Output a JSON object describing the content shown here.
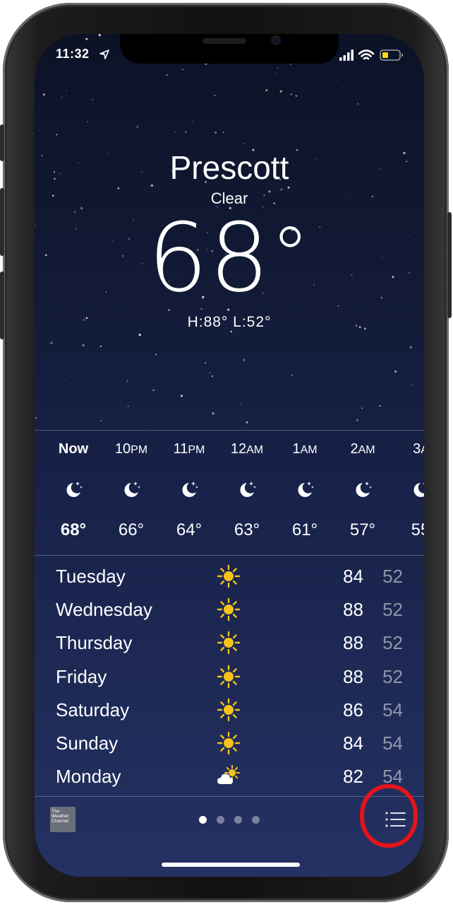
{
  "status": {
    "time": "11:32"
  },
  "location": {
    "city": "Prescott",
    "condition": "Clear",
    "temp": "68",
    "deg": "°",
    "hilo": "H:88°  L:52°"
  },
  "hourly": [
    {
      "label": "Now",
      "suffix": "",
      "temp": "68°",
      "icon": "moon-stars-icon",
      "bold": true
    },
    {
      "label": "10",
      "suffix": "PM",
      "temp": "66°",
      "icon": "moon-stars-icon"
    },
    {
      "label": "11",
      "suffix": "PM",
      "temp": "64°",
      "icon": "moon-stars-icon"
    },
    {
      "label": "12",
      "suffix": "AM",
      "temp": "63°",
      "icon": "moon-stars-icon"
    },
    {
      "label": "1",
      "suffix": "AM",
      "temp": "61°",
      "icon": "moon-stars-icon"
    },
    {
      "label": "2",
      "suffix": "AM",
      "temp": "57°",
      "icon": "moon-stars-icon"
    },
    {
      "label": "3",
      "suffix": "A",
      "temp": "55",
      "icon": "moon-stars-icon"
    }
  ],
  "daily": [
    {
      "day": "Tuesday",
      "hi": "84",
      "lo": "52",
      "icon": "sun-icon"
    },
    {
      "day": "Wednesday",
      "hi": "88",
      "lo": "52",
      "icon": "sun-icon"
    },
    {
      "day": "Thursday",
      "hi": "88",
      "lo": "52",
      "icon": "sun-icon"
    },
    {
      "day": "Friday",
      "hi": "88",
      "lo": "52",
      "icon": "sun-icon"
    },
    {
      "day": "Saturday",
      "hi": "86",
      "lo": "54",
      "icon": "sun-icon"
    },
    {
      "day": "Sunday",
      "hi": "84",
      "lo": "54",
      "icon": "sun-icon"
    },
    {
      "day": "Monday",
      "hi": "82",
      "lo": "54",
      "icon": "partly-cloudy-icon"
    }
  ],
  "footer": {
    "twc_logo": "The Weather Channel",
    "page_count": 4,
    "active_page": 0
  },
  "colors": {
    "accent_highlight": "#e3141b",
    "sun": "#f7c21a",
    "background_top": "#0c1226",
    "background_bottom": "#243163"
  }
}
